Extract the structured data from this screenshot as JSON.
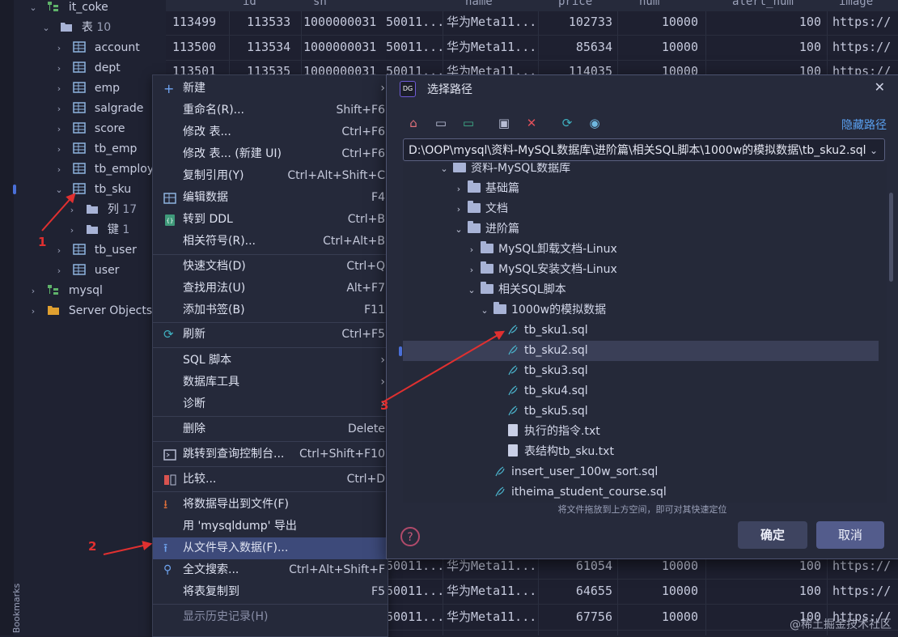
{
  "sidebar": {
    "tree": [
      {
        "label": "it_coke",
        "icon": "schema-icon",
        "expanded": true
      },
      {
        "label": "表",
        "count": "10",
        "icon": "folder-icon",
        "expanded": true
      },
      {
        "label": "account",
        "icon": "table-icon"
      },
      {
        "label": "dept",
        "icon": "table-icon"
      },
      {
        "label": "emp",
        "icon": "table-icon"
      },
      {
        "label": "salgrade",
        "icon": "table-icon"
      },
      {
        "label": "score",
        "icon": "table-icon"
      },
      {
        "label": "tb_emp",
        "icon": "table-icon"
      },
      {
        "label": "tb_employe",
        "icon": "table-icon"
      },
      {
        "label": "tb_sku",
        "icon": "table-icon",
        "expanded": true
      },
      {
        "label": "列",
        "count": "17",
        "icon": "folder-icon"
      },
      {
        "label": "键",
        "count": "1",
        "icon": "folder-icon"
      },
      {
        "label": "tb_user",
        "icon": "table-icon"
      },
      {
        "label": "user",
        "icon": "table-icon"
      },
      {
        "label": "mysql",
        "icon": "schema-icon"
      },
      {
        "label": "Server Objects",
        "icon": "server-objects-icon"
      }
    ],
    "bookmarks_label": "Bookmarks"
  },
  "grid": {
    "headers": [
      "id",
      "sn",
      "name",
      "price",
      "num",
      "alert_num",
      "image"
    ],
    "rows_top": [
      {
        "c0": "113499",
        "c1": "113533",
        "c2": "1000000031",
        "c3": "50011...",
        "c4": "华为Meta11...",
        "c5": "102733",
        "c6": "10000",
        "c7": "100",
        "c8": "https://"
      },
      {
        "c0": "113500",
        "c1": "113534",
        "c2": "1000000031",
        "c3": "50011...",
        "c4": "华为Meta11...",
        "c5": "85634",
        "c6": "10000",
        "c7": "100",
        "c8": "https://"
      },
      {
        "c0": "113501",
        "c1": "113535",
        "c2": "1000000031",
        "c3": "50011...",
        "c4": "华为Meta11...",
        "c5": "114035",
        "c6": "10000",
        "c7": "100",
        "c8": "https://"
      }
    ],
    "rows_bottom": [
      {
        "c3": "50011...",
        "c4": "华为Meta11...",
        "c5": "61054",
        "c6": "10000",
        "c7": "100",
        "c8": "https://"
      },
      {
        "c3": "50011...",
        "c4": "华为Meta11...",
        "c5": "64655",
        "c6": "10000",
        "c7": "100",
        "c8": "https://"
      },
      {
        "c3": "50011...",
        "c4": "华为Meta11...",
        "c5": "67756",
        "c6": "10000",
        "c7": "100",
        "c8": "https://"
      }
    ]
  },
  "context_menu": {
    "items": [
      {
        "label": "新建",
        "shortcut": "",
        "icon": "plus-icon",
        "submenu": true
      },
      {
        "label": "重命名(R)...",
        "shortcut": "Shift+F6"
      },
      {
        "label": "修改 表...",
        "shortcut": "Ctrl+F6"
      },
      {
        "label": "修改 表... (新建 UI)",
        "shortcut": "Ctrl+F6"
      },
      {
        "label": "复制引用(Y)",
        "shortcut": "Ctrl+Alt+Shift+C"
      },
      {
        "label": "编辑数据",
        "shortcut": "F4",
        "icon": "table-edit-icon"
      },
      {
        "label": "转到 DDL",
        "shortcut": "Ctrl+B",
        "icon": "ddl-icon"
      },
      {
        "label": "相关符号(R)...",
        "shortcut": "Ctrl+Alt+B"
      },
      {
        "label": "快速文档(D)",
        "shortcut": "Ctrl+Q"
      },
      {
        "label": "查找用法(U)",
        "shortcut": "Alt+F7"
      },
      {
        "label": "添加书签(B)",
        "shortcut": "F11"
      },
      {
        "label": "刷新",
        "shortcut": "Ctrl+F5",
        "icon": "refresh-icon"
      },
      {
        "label": "SQL 脚本",
        "shortcut": "",
        "submenu": true
      },
      {
        "label": "数据库工具",
        "shortcut": "",
        "submenu": true
      },
      {
        "label": "诊断",
        "shortcut": "",
        "submenu": true
      },
      {
        "label": "删除",
        "shortcut": "Delete"
      },
      {
        "label": "跳转到查询控制台...",
        "shortcut": "Ctrl+Shift+F10",
        "icon": "console-icon"
      },
      {
        "label": "比较...",
        "shortcut": "Ctrl+D",
        "icon": "compare-icon"
      },
      {
        "label": "将数据导出到文件(F)",
        "shortcut": "",
        "icon": "export-icon"
      },
      {
        "label": "用 'mysqldump' 导出",
        "shortcut": ""
      },
      {
        "label": "从文件导入数据(F)...",
        "shortcut": "",
        "icon": "import-icon",
        "selected": true
      },
      {
        "label": "全文搜索...",
        "shortcut": "Ctrl+Alt+Shift+F",
        "icon": "search-icon"
      },
      {
        "label": "将表复制到",
        "shortcut": "F5"
      },
      {
        "label": "显示历史记录(H)",
        "shortcut": "",
        "disabled": true
      }
    ]
  },
  "dialog": {
    "logo_text": "DG",
    "title": "选择路径",
    "close_label": "✕",
    "hide_path_label": "隐藏路径",
    "path_value": "D:\\OOP\\mysql\\资料-MySQL数据库\\进阶篇\\相关SQL脚本\\1000w的模拟数据\\tb_sku2.sql",
    "tree": [
      {
        "label": "资料-MySQL数据库",
        "type": "folder",
        "expanded": true,
        "depth": 0
      },
      {
        "label": "基础篇",
        "type": "folder",
        "depth": 1
      },
      {
        "label": "文档",
        "type": "folder",
        "depth": 1
      },
      {
        "label": "进阶篇",
        "type": "folder",
        "expanded": true,
        "depth": 1
      },
      {
        "label": "MySQL卸载文档-Linux",
        "type": "folder",
        "depth": 2
      },
      {
        "label": "MySQL安装文档-Linux",
        "type": "folder",
        "depth": 2
      },
      {
        "label": "相关SQL脚本",
        "type": "folder",
        "expanded": true,
        "depth": 2
      },
      {
        "label": "1000w的模拟数据",
        "type": "folder",
        "expanded": true,
        "depth": 3
      },
      {
        "label": "tb_sku1.sql",
        "type": "sql",
        "depth": 4
      },
      {
        "label": "tb_sku2.sql",
        "type": "sql",
        "depth": 4,
        "selected": true
      },
      {
        "label": "tb_sku3.sql",
        "type": "sql",
        "depth": 4
      },
      {
        "label": "tb_sku4.sql",
        "type": "sql",
        "depth": 4
      },
      {
        "label": "tb_sku5.sql",
        "type": "sql",
        "depth": 4
      },
      {
        "label": "执行的指令.txt",
        "type": "txt",
        "depth": 4
      },
      {
        "label": "表结构tb_sku.txt",
        "type": "txt",
        "depth": 4
      },
      {
        "label": "insert_user_100w_sort.sql",
        "type": "sql",
        "depth": 3
      },
      {
        "label": "itheima_student_course.sql",
        "type": "sql",
        "depth": 3
      }
    ],
    "hint": "将文件拖放到上方空间，即可对其快速定位",
    "help_label": "?",
    "ok_label": "确定",
    "cancel_label": "取消"
  },
  "annotations": {
    "m1": "1",
    "m2": "2",
    "m3": "3"
  },
  "watermark": "@稀土掘金技术社区",
  "colors": {
    "accent": "#4a6fd8",
    "selection": "#3d4a7a",
    "annotation": "#e03030"
  }
}
